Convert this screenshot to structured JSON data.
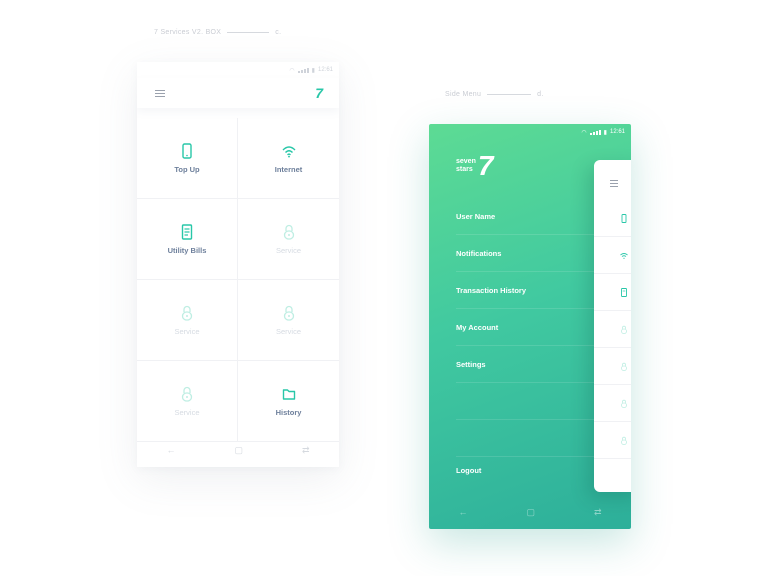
{
  "captions": {
    "left": {
      "title": "7 Services V2. BOX",
      "letter": "c."
    },
    "right": {
      "title": "Side Menu",
      "letter": "d."
    }
  },
  "status": {
    "time_left": "12:61",
    "time_right": "12:61"
  },
  "colors": {
    "accent": "#28c7a8",
    "label": "#6d7f9b",
    "disabled": "#d6dbe2",
    "gradient_start": "#5ddb94",
    "gradient_end": "#2daf9a"
  },
  "services_screen": {
    "logo": "7",
    "tiles": [
      {
        "label": "Top Up",
        "icon": "phone-icon",
        "enabled": true
      },
      {
        "label": "Internet",
        "icon": "wifi-icon",
        "enabled": true
      },
      {
        "label": "Utility Bills",
        "icon": "bill-icon",
        "enabled": true
      },
      {
        "label": "Service",
        "icon": "lock-icon",
        "enabled": false
      },
      {
        "label": "Service",
        "icon": "lock-icon",
        "enabled": false
      },
      {
        "label": "Service",
        "icon": "lock-icon",
        "enabled": false
      },
      {
        "label": "Service",
        "icon": "lock-icon",
        "enabled": false
      },
      {
        "label": "History",
        "icon": "folder-icon",
        "enabled": true
      }
    ],
    "nav": {
      "back": "←",
      "home": "▢",
      "recent": "⇄"
    }
  },
  "side_menu": {
    "brand_line1": "seven",
    "brand_line2": "stars",
    "brand_mark": "7",
    "items": [
      "User Name",
      "Notifications",
      "Transaction History",
      "My Account",
      "Settings"
    ],
    "logout": "Logout",
    "nav": {
      "back": "←",
      "home": "▢",
      "recent": "⇄"
    }
  }
}
